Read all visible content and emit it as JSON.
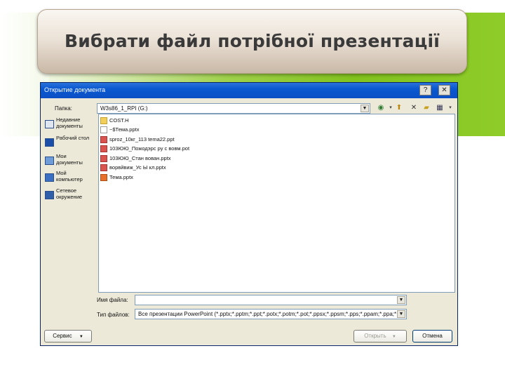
{
  "slide": {
    "title": "Вибрати файл потрібної презентації"
  },
  "dialog": {
    "title": "Открытие документа",
    "help_label": "?",
    "close_label": "✕",
    "lookin_label": "Папка:",
    "lookin_value": "W3s86_1_RPI (G:)",
    "places": [
      {
        "label": "Недавние документы",
        "icon": "recent-docs-icon"
      },
      {
        "label": "Рабочий стол",
        "icon": "desktop-icon"
      },
      {
        "label": "Мои документы",
        "icon": "my-documents-icon"
      },
      {
        "label": "Мой компьютер",
        "icon": "my-computer-icon"
      },
      {
        "label": "Сетевое окружение",
        "icon": "network-icon"
      }
    ],
    "files": [
      {
        "name": "COST.H",
        "icon": "folder-icon"
      },
      {
        "name": "~$Тема.pptx",
        "icon": "pptx-icon"
      },
      {
        "name": "sproz_10кг_113 tema22.ppt",
        "icon": "ppt-icon"
      },
      {
        "name": "103ЮЮ_Пожодэрс ру с вовм.pot",
        "icon": "ppt-icon"
      },
      {
        "name": "103ЮЮ_Стан вован.pptx",
        "icon": "ppt-icon"
      },
      {
        "name": "ворвйвиж_Ус Ы кл.pptx",
        "icon": "ppt-icon"
      },
      {
        "name": "Тема.pptx",
        "icon": "pptx-icon"
      }
    ],
    "filename_label": "Имя файла:",
    "filename_value": "",
    "filetype_label": "Тип файлов:",
    "filetype_value": "Все презентации PowerPoint (*.pptx;*.pptm;*.ppt;*.potx;*.potm;*.pot;*.ppsx;*.ppsm;*.pps;*.ppam;*.ppa;*.xml;*.pot",
    "service_label": "Сервис",
    "open_label": "Открыть",
    "cancel_label": "Отмена"
  }
}
